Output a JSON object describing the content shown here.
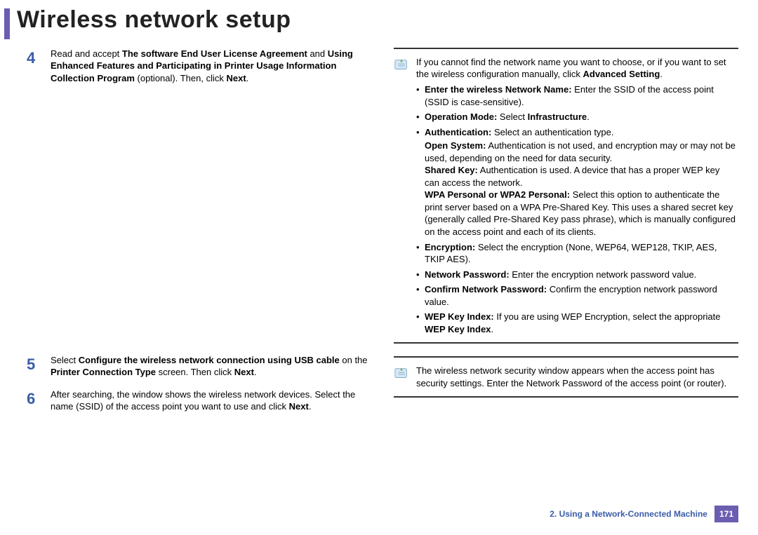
{
  "title": "Wireless network setup",
  "left": {
    "steps": [
      {
        "num": "4",
        "body_pre": "Read and accept ",
        "b1": "The software End User License Agreement",
        "body_mid": " and ",
        "b2": "Using Enhanced Features and Participating in Printer Usage Information Collection Program",
        "body_post": " (optional). Then, click ",
        "b3": "Next",
        "body_end": "."
      },
      {
        "num": "5",
        "body_pre": "Select ",
        "b1": "Configure the wireless network connection using USB cable",
        "body_mid": " on the ",
        "b2": "Printer Connection Type",
        "body_post": " screen. Then click ",
        "b3": "Next",
        "body_end": "."
      },
      {
        "num": "6",
        "body_pre": "After searching, the window shows the wireless network devices. Select the name (SSID) of the access point you want to use and click ",
        "b1": "Next",
        "body_end": "."
      }
    ]
  },
  "note1": {
    "lead": "If you cannot find the network name you want to choose, or if you want to set the wireless configuration manually, click ",
    "adv": "Advanced Setting",
    "items": [
      {
        "label": "Enter the wireless Network Name:",
        "tail": " Enter the SSID of the access point (SSID is case-sensitive)."
      },
      {
        "label": "Operation Mode:",
        "tail_pre": " Select ",
        "bold_tail": "Infrastructure",
        "tail_post": "."
      },
      {
        "label": "Authentication:",
        "tail": " Select an authentication type.",
        "subitems": [
          {
            "label": "Open System:",
            "tail": " Authentication is not used, and encryption may or may not be used, depending on the need for data security."
          },
          {
            "label": "Shared Key:",
            "tail": " Authentication is used. A device that has a proper WEP key can access the network."
          },
          {
            "label": "WPA Personal or WPA2 Personal:",
            "tail": " Select this option to authenticate the print server based on a WPA Pre-Shared Key. This uses a shared secret key (generally called Pre-Shared Key pass phrase), which is manually configured on the access point and each of its clients."
          }
        ]
      },
      {
        "label": "Encryption:",
        "tail": " Select the encryption (None, WEP64, WEP128, TKIP, AES, TKIP AES)."
      },
      {
        "label": "Network Password:",
        "tail": " Enter the encryption network password value."
      },
      {
        "label": "Confirm Network Password:",
        "tail": " Confirm the encryption network password value."
      },
      {
        "label": "WEP Key Index:",
        "tail_pre": " If you are using WEP Encryption, select the appropriate ",
        "bold_tail": "WEP Key Index",
        "tail_post": "."
      }
    ]
  },
  "note2": {
    "body": "The wireless network security window appears when the access point has security settings. Enter the Network Password of the access point (or router)."
  },
  "footer": {
    "section": "2.  Using a Network-Connected Machine",
    "page": "171"
  }
}
